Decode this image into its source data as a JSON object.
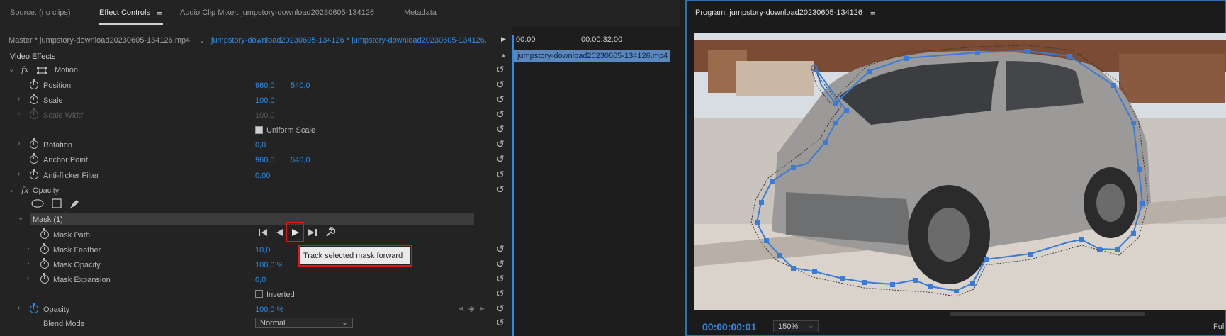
{
  "tabs": {
    "source": "Source: (no clips)",
    "effect_controls": "Effect Controls",
    "audio_mixer": "Audio Clip Mixer: jumpstory-download20230605-134126",
    "metadata": "Metadata",
    "program": "Program: jumpstory-download20230605-134126"
  },
  "header": {
    "master": "Master * jumpstory-download20230605-134126.mp4",
    "clip": "jumpstory-download20230605-134126 * jumpstory-download20230605-134126..."
  },
  "timeline": {
    "t0": "00:00",
    "t1": "00:00:32:00",
    "clip_label": "jumpstory-download20230605-134126.mp4"
  },
  "video_effects": "Video Effects",
  "motion": {
    "label": "Motion",
    "position": {
      "label": "Position",
      "x": "960,0",
      "y": "540,0"
    },
    "scale": {
      "label": "Scale",
      "value": "100,0"
    },
    "scale_width": {
      "label": "Scale Width",
      "value": "100,0"
    },
    "uniform_scale": "Uniform Scale",
    "rotation": {
      "label": "Rotation",
      "value": "0,0"
    },
    "anchor": {
      "label": "Anchor Point",
      "x": "960,0",
      "y": "540,0"
    },
    "antiflicker": {
      "label": "Anti-flicker Filter",
      "value": "0,00"
    }
  },
  "opacity": {
    "label": "Opacity",
    "mask": "Mask (1)",
    "mask_path": "Mask Path",
    "mask_feather": {
      "label": "Mask Feather",
      "value": "10,0"
    },
    "mask_opacity": {
      "label": "Mask Opacity",
      "value": "100,0 %"
    },
    "mask_expansion": {
      "label": "Mask Expansion",
      "value": "0,0"
    },
    "inverted": "Inverted",
    "opacity_value": {
      "label": "Opacity",
      "value": "100,0 %"
    },
    "blend": {
      "label": "Blend Mode",
      "value": "Normal"
    }
  },
  "tooltip": "Track selected mask forward",
  "program": {
    "timecode": "00:00:00:01",
    "zoom": "150%",
    "quality": "Ful"
  },
  "colors": {
    "accent": "#2d8ceb",
    "highlight": "#e0161b",
    "mask": "#3b7bd6"
  }
}
